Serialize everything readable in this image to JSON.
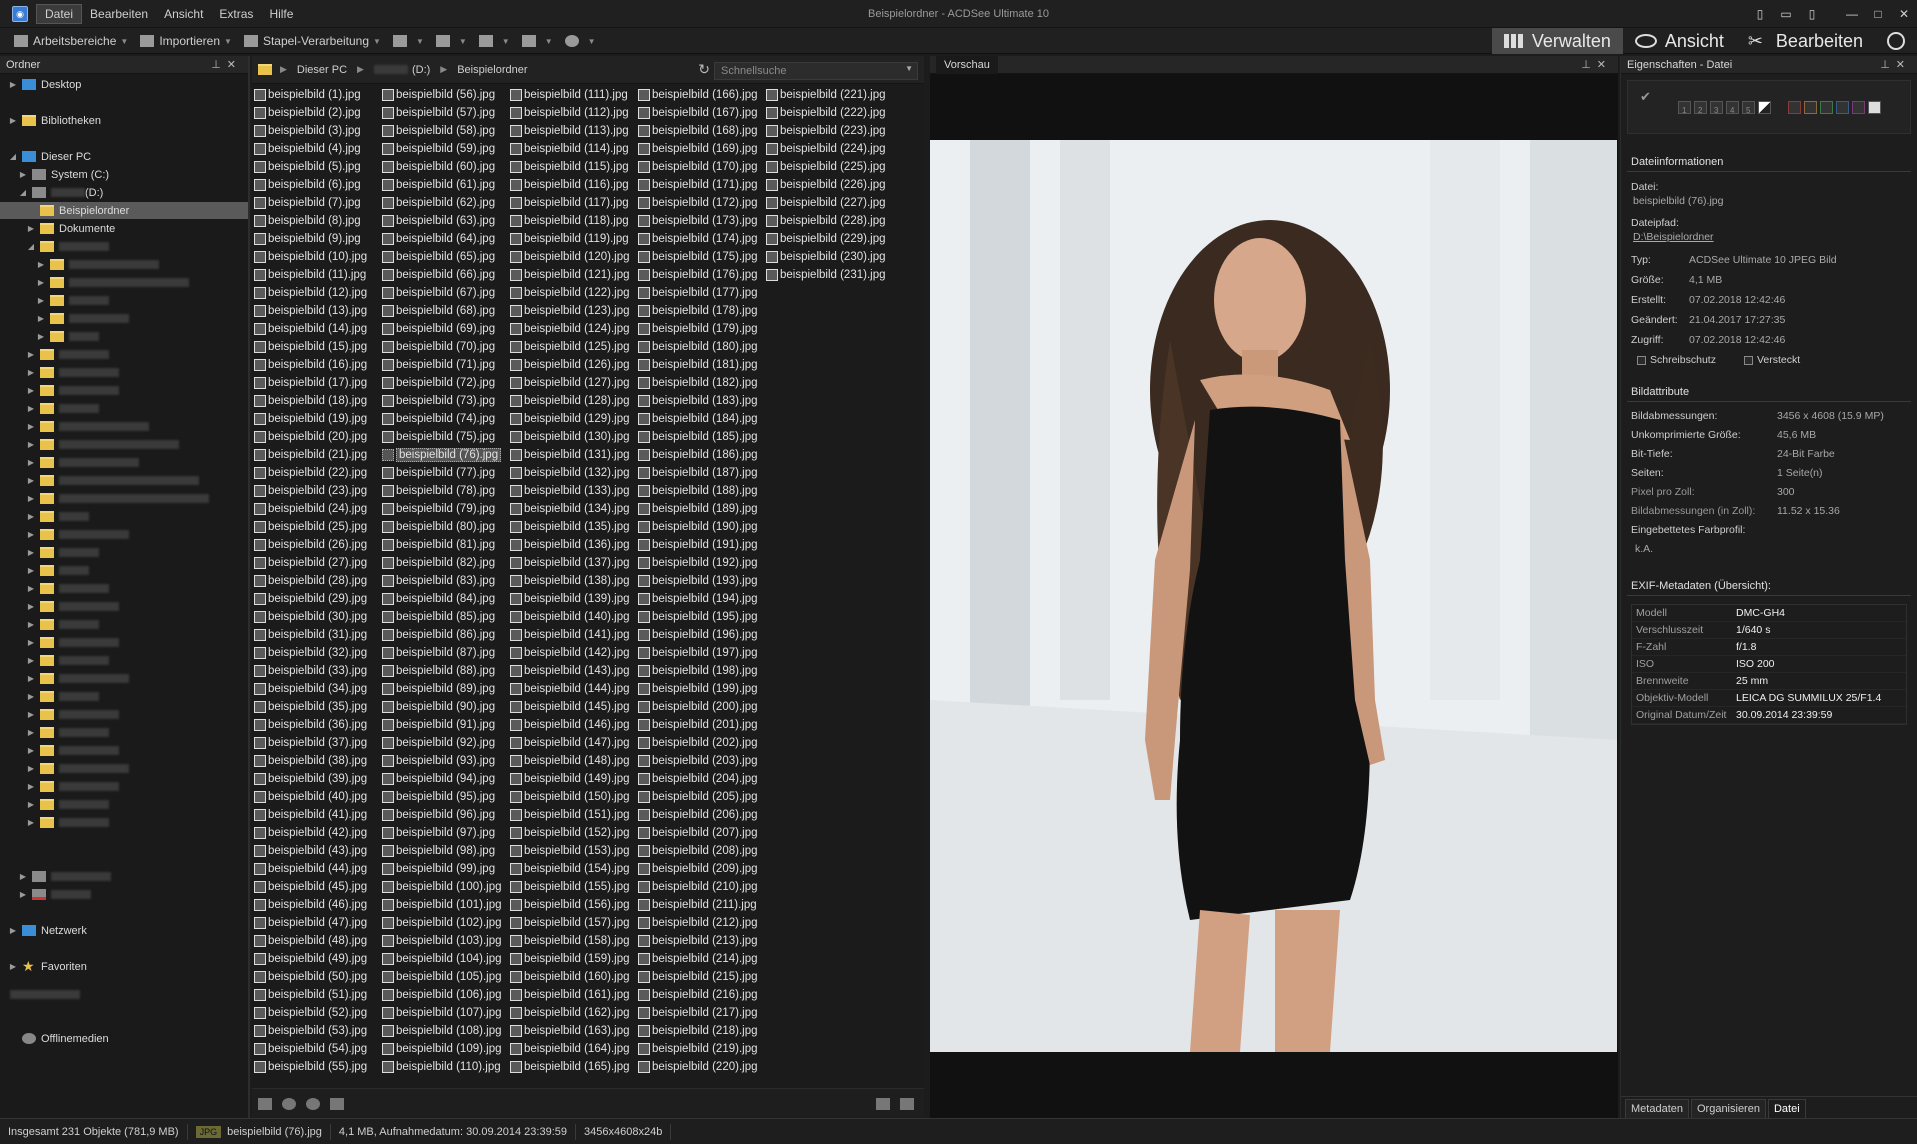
{
  "window": {
    "title": "Beispielordner - ACDSee Ultimate 10",
    "menu": [
      "Datei",
      "Bearbeiten",
      "Ansicht",
      "Extras",
      "Hilfe"
    ]
  },
  "toolbar": {
    "workspaces": "Arbeitsbereiche",
    "import": "Importieren",
    "batch": "Stapel-Verarbeitung"
  },
  "modes": {
    "manage": "Verwalten",
    "view": "Ansicht",
    "edit": "Bearbeiten"
  },
  "folders_panel": {
    "title": "Ordner",
    "desktop": "Desktop",
    "libraries": "Bibliotheken",
    "this_pc": "Dieser PC",
    "system_drive": "System (C:)",
    "d_drive": "(D:)",
    "example_folder": "Beispielordner",
    "documents": "Dokumente",
    "network": "Netzwerk",
    "favorites": "Favoriten",
    "offline_media": "Offlinemedien"
  },
  "browser": {
    "breadcrumb": [
      "Dieser PC",
      "(D:)",
      "Beispielordner"
    ],
    "search_placeholder": "Schnellsuche",
    "file_prefix": "beispielbild (",
    "file_suffix": ").jpg",
    "total_files": 231,
    "rows_per_column": 55,
    "selected_index": 76
  },
  "preview": {
    "title": "Vorschau"
  },
  "properties": {
    "title": "Eigenschaften - Datei",
    "rating_numbers": [
      "1",
      "2",
      "3",
      "4",
      "5"
    ],
    "file_info_header": "Dateiinformationen",
    "file_label": "Datei:",
    "file_name": "beispielbild (76).jpg",
    "path_label": "Dateipfad:",
    "path_value": "D:\\Beispielordner",
    "info": [
      {
        "k": "Typ:",
        "v": "ACDSee Ultimate 10 JPEG Bild"
      },
      {
        "k": "Größe:",
        "v": "4,1 MB"
      },
      {
        "k": "Erstellt:",
        "v": "07.02.2018 12:42:46"
      },
      {
        "k": "Geändert:",
        "v": "21.04.2017 17:27:35"
      },
      {
        "k": "Zugriff:",
        "v": "07.02.2018 12:42:46"
      }
    ],
    "readonly_label": "Schreibschutz",
    "hidden_label": "Versteckt",
    "image_attr_header": "Bildattribute",
    "attributes": [
      {
        "k": "Bildabmessungen:",
        "v": "3456 x 4608 (15.9 MP)"
      },
      {
        "k": "Unkomprimierte Größe:",
        "v": "45,6 MB"
      },
      {
        "k": "Bit-Tiefe:",
        "v": "24-Bit Farbe"
      },
      {
        "k": "Seiten:",
        "v": "1 Seite(n)"
      },
      {
        "k": "Pixel pro Zoll:",
        "v": "300"
      },
      {
        "k": "Bildabmessungen (in Zoll):",
        "v": "11.52 x 15.36"
      },
      {
        "k": "Eingebettetes Farbprofil:",
        "v": ""
      }
    ],
    "color_profile_value": "k.A.",
    "exif_header": "EXIF-Metadaten (Übersicht):",
    "exif": [
      {
        "k": "Modell",
        "v": "DMC-GH4"
      },
      {
        "k": "Verschlusszeit",
        "v": "1/640 s"
      },
      {
        "k": "F-Zahl",
        "v": "f/1.8"
      },
      {
        "k": "ISO",
        "v": "ISO 200"
      },
      {
        "k": "Brennweite",
        "v": "25 mm"
      },
      {
        "k": "Objektiv-Modell",
        "v": "LEICA DG SUMMILUX 25/F1.4"
      },
      {
        "k": "Original Datum/Zeit",
        "v": "30.09.2014 23:39:59"
      }
    ],
    "tabs": [
      "Metadaten",
      "Organisieren",
      "Datei"
    ]
  },
  "status": {
    "total": "Insgesamt 231 Objekte  (781,9 MB)",
    "badge": "JPG",
    "file": "beispielbild (76).jpg",
    "info": "4,1 MB, Aufnahmedatum: 30.09.2014 23:39:59",
    "dims": "3456x4608x24b"
  },
  "colors": {
    "accent": "#3a7bd5",
    "folder": "#e8c24a",
    "background": "#1c1c1c"
  }
}
